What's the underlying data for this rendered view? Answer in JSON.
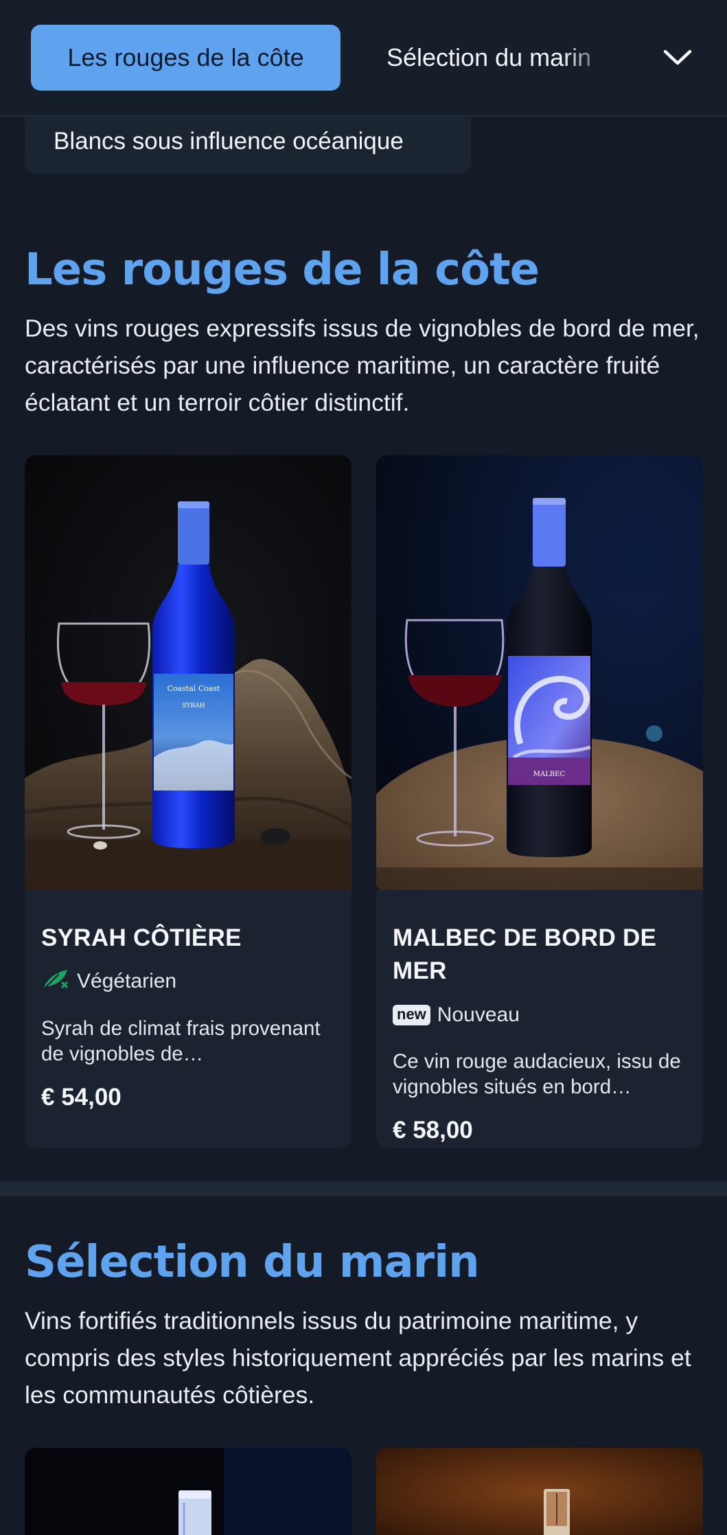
{
  "nav": {
    "active_tab": "Les rouges de la côte",
    "next_tab": "Sélection du marin",
    "dropdown_item": "Blancs sous influence océanique"
  },
  "sections": [
    {
      "title": "Les rouges de la côte",
      "description": "Des vins rouges expressifs issus de vignobles de bord de mer, caractérisés par une influence maritime, un caractère fruité éclatant et un terroir côtier distinctif.",
      "products": [
        {
          "name": "SYRAH CÔTIÈRE",
          "tag": "Végétarien",
          "tag_icon": "vegetarian-icon",
          "description": "Syrah de climat frais provenant de vignobles de…",
          "price": "€ 54,00",
          "label_text": "Coastal Coast",
          "label_sub": "SYRAH",
          "image_alt": "bottle-with-glass-on-driftwood"
        },
        {
          "name": "MALBEC DE BORD DE MER",
          "badge": "new",
          "tag": "Nouveau",
          "description": "Ce vin rouge audacieux, issu de vignobles situés en bord…",
          "price": "€ 58,00",
          "label_sub": "MALBEC",
          "image_alt": "bottle-with-wave-label-and-glass"
        }
      ]
    },
    {
      "title": "Sélection du marin",
      "description": "Vins fortifiés traditionnels issus du patrimoine maritime, y compris des styles historiquement appréciés par les marins et les communautés côtières."
    }
  ],
  "colors": {
    "background": "#141b26",
    "accent": "#5fa3ef",
    "card": "#1b2330",
    "vegetarian": "#19a463"
  }
}
